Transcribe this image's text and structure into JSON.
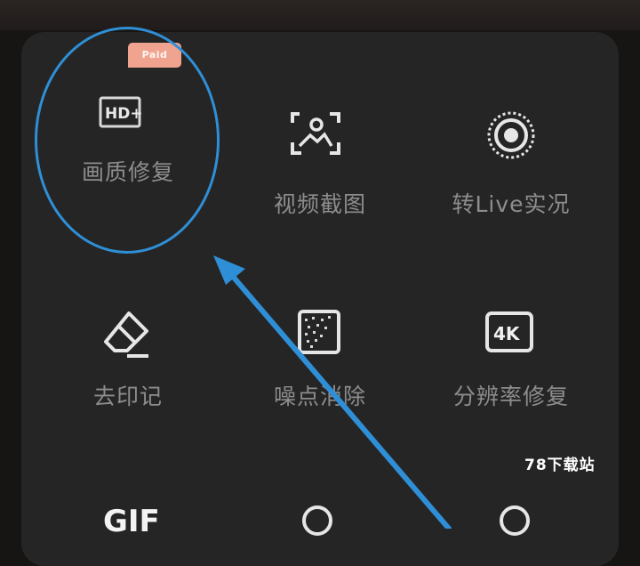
{
  "tools": [
    {
      "id": "hd",
      "label": "画质修复",
      "icon": "hd-plus-icon",
      "badge": "Paid"
    },
    {
      "id": "screenshot",
      "label": "视频截图",
      "icon": "frame-capture-icon"
    },
    {
      "id": "live",
      "label": "转Live实况",
      "icon": "live-photo-icon"
    },
    {
      "id": "remove-mark",
      "label": "去印记",
      "icon": "eraser-icon"
    },
    {
      "id": "denoise",
      "label": "噪点消除",
      "icon": "noise-grid-icon"
    },
    {
      "id": "resolution",
      "label": "分辨率修复",
      "icon": "4k-icon"
    }
  ],
  "icon_text": {
    "hd": "HD+",
    "resolution": "4K"
  },
  "partial_row": {
    "gif_text": "GIF"
  },
  "watermark": "78下载站",
  "colors": {
    "panel": "#252525",
    "label": "#8d8d8d",
    "highlight": "#2f8fd6",
    "badge": "#f0a38e"
  }
}
